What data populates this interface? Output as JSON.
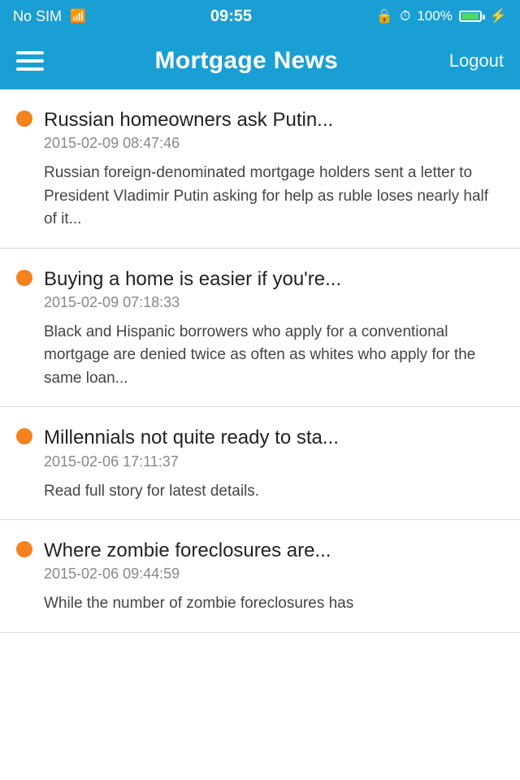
{
  "status_bar": {
    "carrier": "No SIM",
    "time": "09:55",
    "battery": "100%"
  },
  "nav": {
    "title": "Mortgage News",
    "logout_label": "Logout"
  },
  "news_items": [
    {
      "title": "Russian homeowners ask Putin...",
      "date": "2015-02-09 08:47:46",
      "excerpt": "Russian foreign-denominated mortgage holders sent a letter to President Vladimir Putin asking for help as ruble loses nearly half of it..."
    },
    {
      "title": "Buying a home is easier if you're...",
      "date": "2015-02-09 07:18:33",
      "excerpt": "Black and Hispanic borrowers who apply for a conventional mortgage are denied twice as often as whites who apply for the same loan..."
    },
    {
      "title": "Millennials not quite ready to sta...",
      "date": "2015-02-06 17:11:37",
      "excerpt": "Read full story for latest details."
    },
    {
      "title": "Where zombie foreclosures are...",
      "date": "2015-02-06 09:44:59",
      "excerpt": "While the number of zombie foreclosures has"
    }
  ]
}
